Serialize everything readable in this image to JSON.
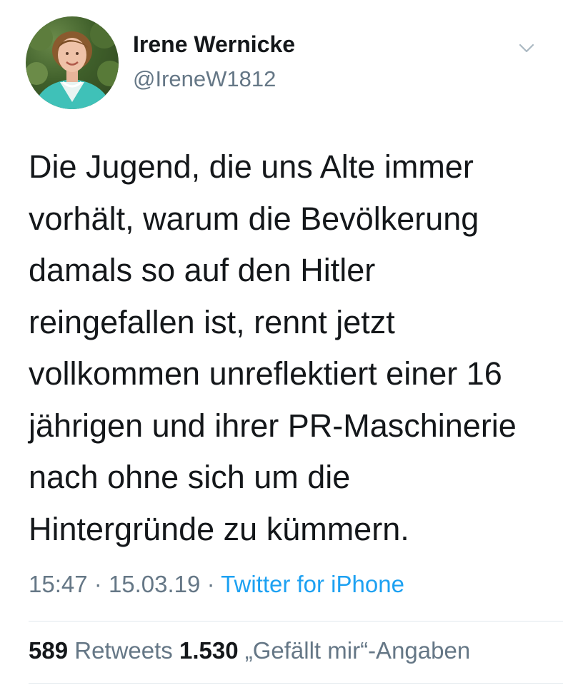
{
  "author": {
    "display_name": "Irene Wernicke",
    "handle": "@IreneW1812"
  },
  "tweet": {
    "lines": [
      "Die Jugend, die uns Alte immer",
      "vorhält, warum die Bevölkerung",
      "damals so auf den Hitler",
      "reingefallen ist, rennt jetzt",
      "vollkommen unreflektiert einer 16",
      "jährigen und ihrer PR-Maschinerie",
      "nach ohne sich um die",
      "Hintergründe zu kümmern."
    ],
    "time": "15:47",
    "date": "15.03.19",
    "separator": "·",
    "source": "Twitter for iPhone"
  },
  "stats": {
    "retweets_count": "589",
    "retweets_label": "Retweets",
    "likes_count": "1.530",
    "likes_label": "„Gefällt mir“-Angaben"
  },
  "icons": {
    "menu": "chevron-down-icon",
    "avatar": "profile-photo"
  },
  "colors": {
    "text_primary": "#14171a",
    "text_secondary": "#657786",
    "link": "#1da1f2",
    "divider": "#e1e8ed"
  }
}
